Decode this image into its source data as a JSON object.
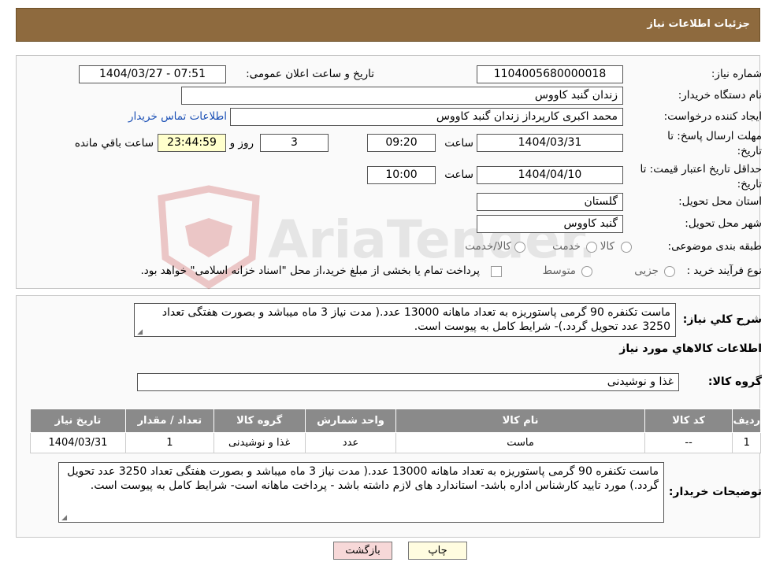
{
  "header": {
    "title": "جزئیات اطلاعات نیاز"
  },
  "form": {
    "need_number_label": "شماره نیاز:",
    "need_number": "1104005680000018",
    "announce_label": "تاریخ و ساعت اعلان عمومی:",
    "announce_value": "1404/03/27 - 07:51",
    "buyer_org_label": "نام دستگاه خریدار:",
    "buyer_org": "زندان گنبد کاووس",
    "requester_label": "ایجاد کننده درخواست:",
    "requester": "محمد اکبری کارپرداز زندان گنبد کاووس",
    "contact_link": "اطلاعات تماس خریدار",
    "deadline_label": "مهلت ارسال پاسخ: تا تاریخ:",
    "deadline_date": "1404/03/31",
    "time_label": "ساعت",
    "deadline_time": "09:20",
    "days_value": "3",
    "days_label": "روز و",
    "remaining_time": "23:44:59",
    "remaining_label": "ساعت باقي مانده",
    "validity_label": "حداقل تاریخ اعتبار قیمت: تا تاریخ:",
    "validity_date": "1404/04/10",
    "validity_time": "10:00",
    "province_label": "استان محل تحویل:",
    "province": "گلستان",
    "city_label": "شهر محل تحویل:",
    "city": "گنبد کاووس",
    "category_label": "طبقه بندی موضوعی:",
    "category_options": [
      "کالا",
      "خدمت",
      "کالا/خدمت"
    ],
    "process_label": "نوع فرآیند خرید :",
    "process_options": [
      "جزیی",
      "متوسط"
    ],
    "payment_note": "پرداخت تمام یا بخشی از مبلغ خرید،از محل \"اسناد خزانه اسلامی\" خواهد بود."
  },
  "description": {
    "label": "شرح کلي نياز:",
    "text": "ماست تکنفره 90 گرمی پاستوریزه به تعداد ماهانه 13000 عدد.( مدت نیاز 3 ماه میباشد و بصورت هفتگی تعداد 3250 عدد تحویل گردد.)- شرایط کامل به پیوست است."
  },
  "goods": {
    "section_title": "اطلاعات کالاهاي مورد نياز",
    "group_label": "گروه کالا:",
    "group_value": "غذا و نوشیدنی",
    "columns": [
      "ردیف",
      "کد کالا",
      "نام کالا",
      "واحد شمارش",
      "گروه کالا",
      "تعداد / مقدار",
      "تاریخ نیاز"
    ],
    "rows": [
      [
        "1",
        "--",
        "ماست",
        "عدد",
        "غذا و نوشیدنی",
        "1",
        "1404/03/31"
      ]
    ]
  },
  "buyer_notes": {
    "label": "توضیحات خریدار:",
    "text": "ماست تکنفره 90 گرمی پاستوریزه به تعداد ماهانه 13000 عدد.( مدت نیاز 3 ماه میباشد و بصورت هفتگی تعداد 3250 عدد تحویل گردد.) مورد تایید کارشناس اداره باشد- استاندارد های لازم داشته باشد - پرداخت ماهانه است- شرایط کامل به پیوست است."
  },
  "buttons": {
    "print": "چاپ",
    "back": "بازگشت"
  },
  "watermark_text": "AriaTender.neT",
  "colors": {
    "header_bg": "#8e6a3e",
    "table_header": "#8a8a8a",
    "link": "#1a4fb5",
    "back_button_bg": "#f7d8d8",
    "print_button_bg": "#fffce0"
  }
}
